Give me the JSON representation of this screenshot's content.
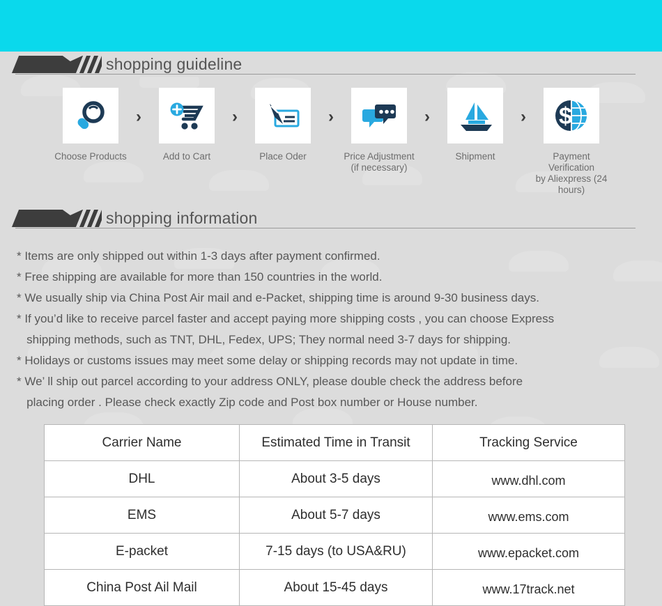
{
  "colors": {
    "banner": "#0ad9ec",
    "page_bg": "#dcdcdc",
    "icon_dark": "#1d3a55",
    "icon_cyan": "#29a9e0",
    "header_dark": "#3d3d3d",
    "text_gray": "#585858"
  },
  "sections": {
    "guideline": {
      "title": "shopping guideline"
    },
    "information": {
      "title": "shopping information"
    }
  },
  "steps": [
    {
      "icon": "magnifier-icon",
      "label": "Choose Products"
    },
    {
      "icon": "shopping-cart-plus-icon",
      "label": "Add to Cart"
    },
    {
      "icon": "pen-check-icon",
      "label": "Place Oder"
    },
    {
      "icon": "chat-bubbles-icon",
      "label": "Price Adjustment\n(if necessary)"
    },
    {
      "icon": "sailboat-icon",
      "label": "Shipment"
    },
    {
      "icon": "dollar-globe-icon",
      "label": "Payment Verification\nby  Aliexpress (24 hours)"
    }
  ],
  "step_separator": "›",
  "info_lines": [
    "* Items are only shipped out within 1-3 days after payment confirmed.",
    "* Free shipping are available for more than 150 countries in the world.",
    "* We usually ship via China Post Air mail and e-Packet, shipping time is around 9-30 business days.",
    "* If you’d like to receive parcel faster and accept paying more shipping costs , you can choose Express",
    "   shipping methods, such as TNT, DHL, Fedex, UPS; They normal need 3-7 days for shipping.",
    "* Holidays or customs issues may meet some delay or shipping records may not update in time.",
    "* We’ ll ship out parcel according to your address ONLY, please double check the address before",
    "   placing order . Please check exactly Zip code and Post box number or House number."
  ],
  "table": {
    "headers": [
      "Carrier Name",
      "Estimated Time in Transit",
      "Tracking Service"
    ],
    "rows": [
      [
        "DHL",
        "About 3-5 days",
        "www.dhl.com"
      ],
      [
        "EMS",
        "About 5-7 days",
        "www.ems.com"
      ],
      [
        "E-packet",
        "7-15 days (to USA&RU)",
        "www.epacket.com"
      ],
      [
        "China Post Ail Mail",
        "About 15-45 days",
        "www.17track.net"
      ]
    ]
  }
}
